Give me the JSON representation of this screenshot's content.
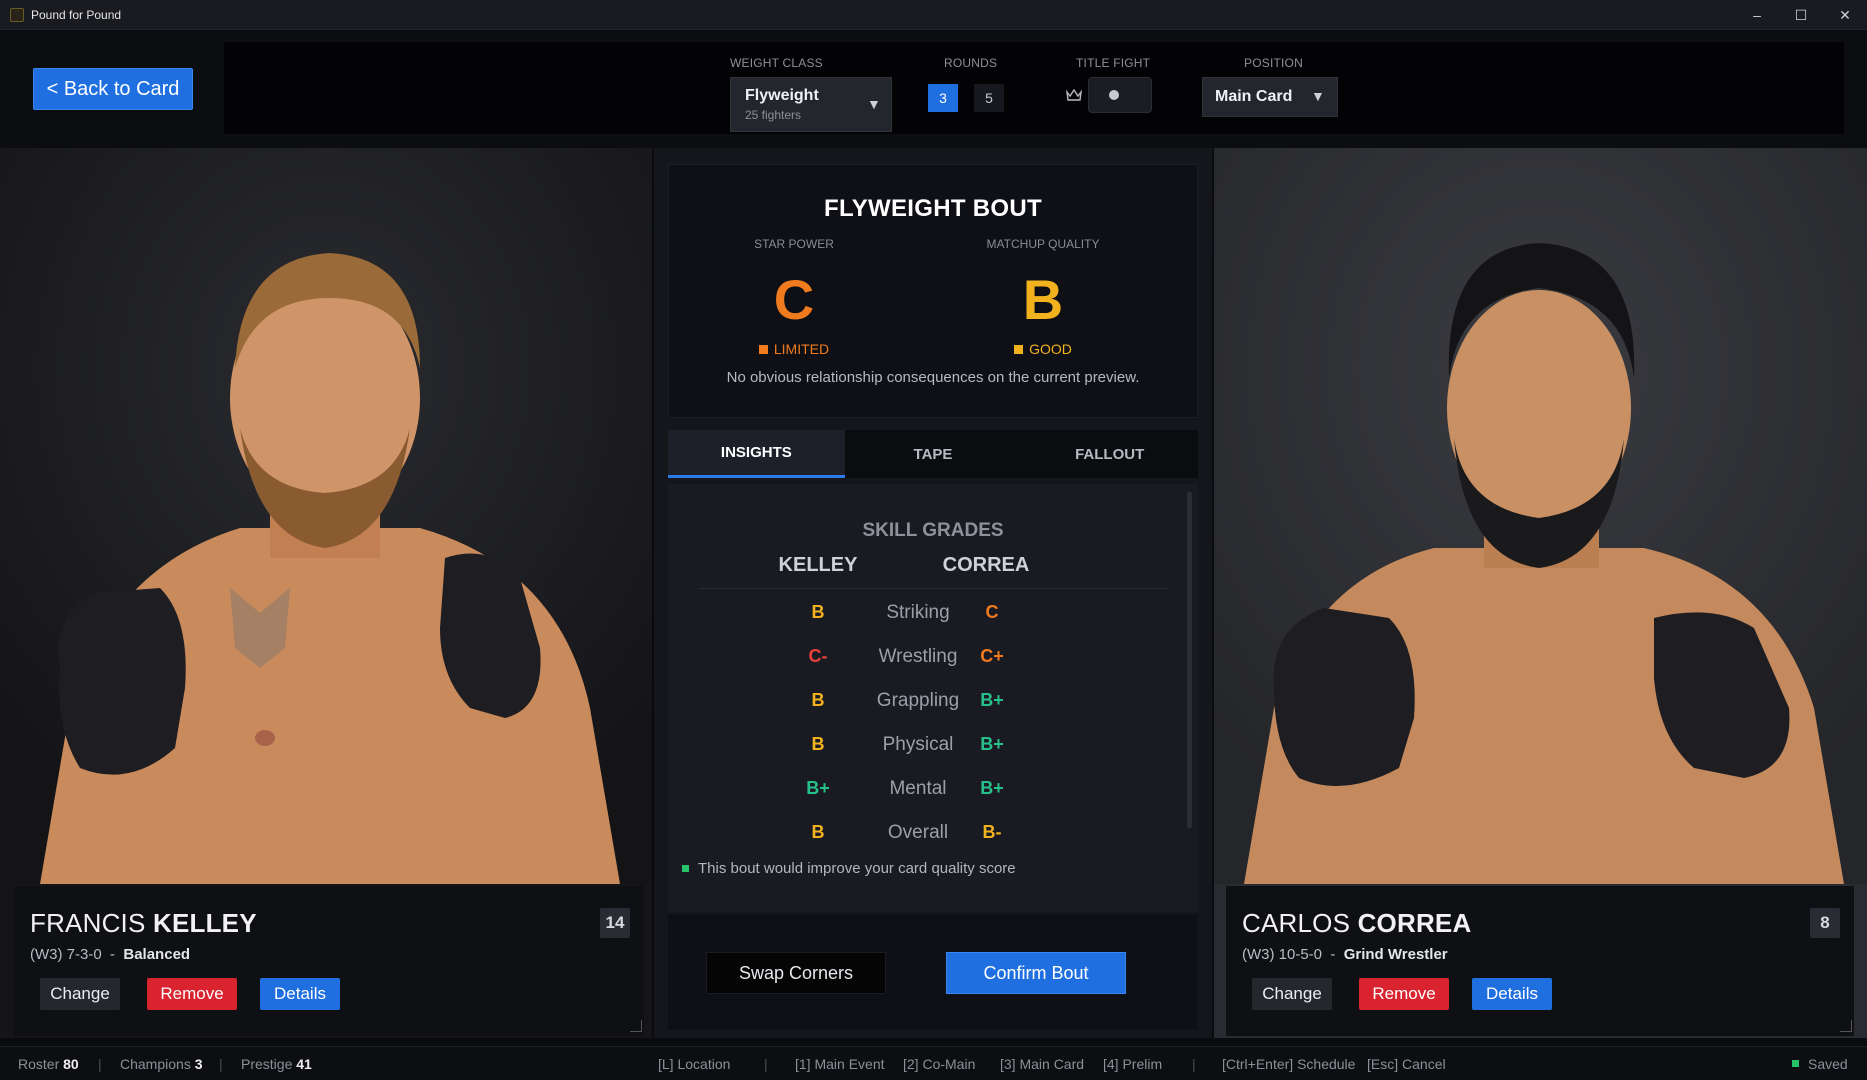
{
  "window": {
    "title": "Pound for Pound",
    "minimize": "–",
    "maximize": "☐",
    "close": "✕"
  },
  "header": {
    "back_label": "< Back to Card",
    "weight_class": {
      "label": "WEIGHT CLASS",
      "value": "Flyweight",
      "sub": "25 fighters"
    },
    "rounds": {
      "label": "ROUNDS",
      "options": [
        "3",
        "5"
      ],
      "selected": "3"
    },
    "title_fight": {
      "label": "TITLE FIGHT",
      "enabled": false
    },
    "position": {
      "label": "POSITION",
      "value": "Main Card"
    }
  },
  "left_fighter": {
    "first_name": "FRANCIS",
    "last_name": "KELLEY",
    "record": "(W3) 7-3-0",
    "style": "Balanced",
    "rank": "14",
    "buttons": {
      "change": "Change",
      "remove": "Remove",
      "details": "Details"
    }
  },
  "right_fighter": {
    "first_name": "CARLOS",
    "last_name": "CORREA",
    "record": "(W3) 10-5-0",
    "style": "Grind Wrestler",
    "rank": "8",
    "buttons": {
      "change": "Change",
      "remove": "Remove",
      "details": "Details"
    }
  },
  "bout": {
    "title": "FLYWEIGHT BOUT",
    "star_power": {
      "label": "STAR POWER",
      "grade": "C",
      "status": "LIMITED",
      "color": "#f07a1e"
    },
    "matchup_quality": {
      "label": "MATCHUP QUALITY",
      "grade": "B",
      "status": "GOOD",
      "color": "#f2b21e"
    },
    "note": "No obvious relationship consequences on the current preview."
  },
  "tabs": [
    "INSIGHTS",
    "TAPE",
    "FALLOUT"
  ],
  "active_tab": "INSIGHTS",
  "skills": {
    "title": "SKILL GRADES",
    "left_name": "KELLEY",
    "right_name": "CORREA",
    "rows": [
      {
        "skill": "Striking",
        "left": "B",
        "right": "C"
      },
      {
        "skill": "Wrestling",
        "left": "C-",
        "right": "C+"
      },
      {
        "skill": "Grappling",
        "left": "B",
        "right": "B+"
      },
      {
        "skill": "Physical",
        "left": "B",
        "right": "B+"
      },
      {
        "skill": "Mental",
        "left": "B+",
        "right": "B+"
      },
      {
        "skill": "Overall",
        "left": "B",
        "right": "B-"
      }
    ],
    "improve_note": "This bout would improve your card quality score"
  },
  "grade_colors": {
    "B+": "#27c08a",
    "B": "#f2b21e",
    "B-": "#f2b21e",
    "C+": "#f07a1e",
    "C": "#f07a1e",
    "C-": "#e8413c"
  },
  "actions": {
    "swap": "Swap Corners",
    "confirm": "Confirm Bout"
  },
  "statusbar": {
    "roster_label": "Roster",
    "roster": "80",
    "champions_label": "Champions",
    "champions": "3",
    "prestige_label": "Prestige",
    "prestige": "41",
    "shortcuts": [
      "[L] Location",
      "[1] Main Event",
      "[2] Co-Main",
      "[3] Main Card",
      "[4] Prelim",
      "[Ctrl+Enter] Schedule",
      "[Esc] Cancel"
    ],
    "saved": "Saved"
  },
  "icons": {
    "app": "app-icon",
    "crown": "crown-icon",
    "dropdown": "chevron-down-icon"
  }
}
